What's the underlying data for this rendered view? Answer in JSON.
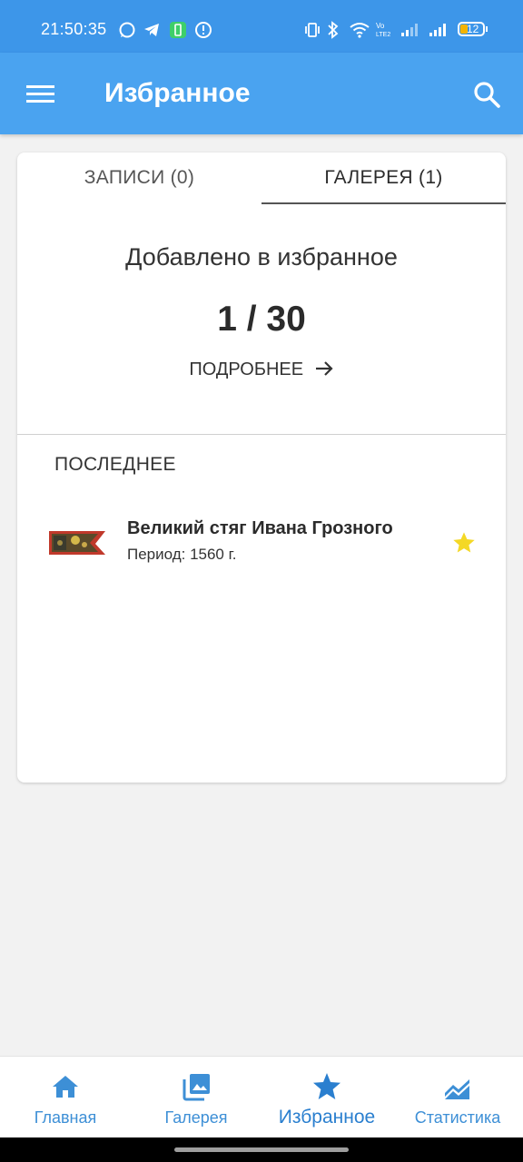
{
  "status_bar": {
    "time": "21:50:35",
    "battery": "12",
    "icons": [
      "whatsapp-icon",
      "telegram-icon",
      "battery-saver-icon",
      "alert-icon",
      "vibrate-icon",
      "bluetooth-icon",
      "wifi-icon",
      "volte-icon",
      "signal-icon",
      "battery-icon"
    ]
  },
  "app_bar": {
    "title": "Избранное",
    "menu_icon": "menu-icon",
    "search_icon": "search-icon"
  },
  "tabs": [
    {
      "label": "ЗАПИСИ (0)",
      "active": false
    },
    {
      "label": "ГАЛЕРЕЯ (1)",
      "active": true
    }
  ],
  "summary": {
    "label": "Добавлено в избранное",
    "count": "1 / 30",
    "more_label": "ПОДРОБНЕЕ"
  },
  "recent": {
    "title": "ПОСЛЕДНЕЕ",
    "items": [
      {
        "title": "Великий стяг Ивана Грозного",
        "subtitle": "Период: 1560 г.",
        "favorite": true
      }
    ]
  },
  "bottom_nav": {
    "items": [
      {
        "label": "Главная",
        "icon": "home-icon",
        "active": false
      },
      {
        "label": "Галерея",
        "icon": "gallery-icon",
        "active": false
      },
      {
        "label": "Избранное",
        "icon": "star-icon",
        "active": true
      },
      {
        "label": "Статистика",
        "icon": "stats-icon",
        "active": false
      }
    ]
  },
  "colors": {
    "primary": "#4aa3f0",
    "status_bar": "#3d96e9",
    "nav_accent": "#2a7fcf",
    "star": "#f4d826"
  }
}
